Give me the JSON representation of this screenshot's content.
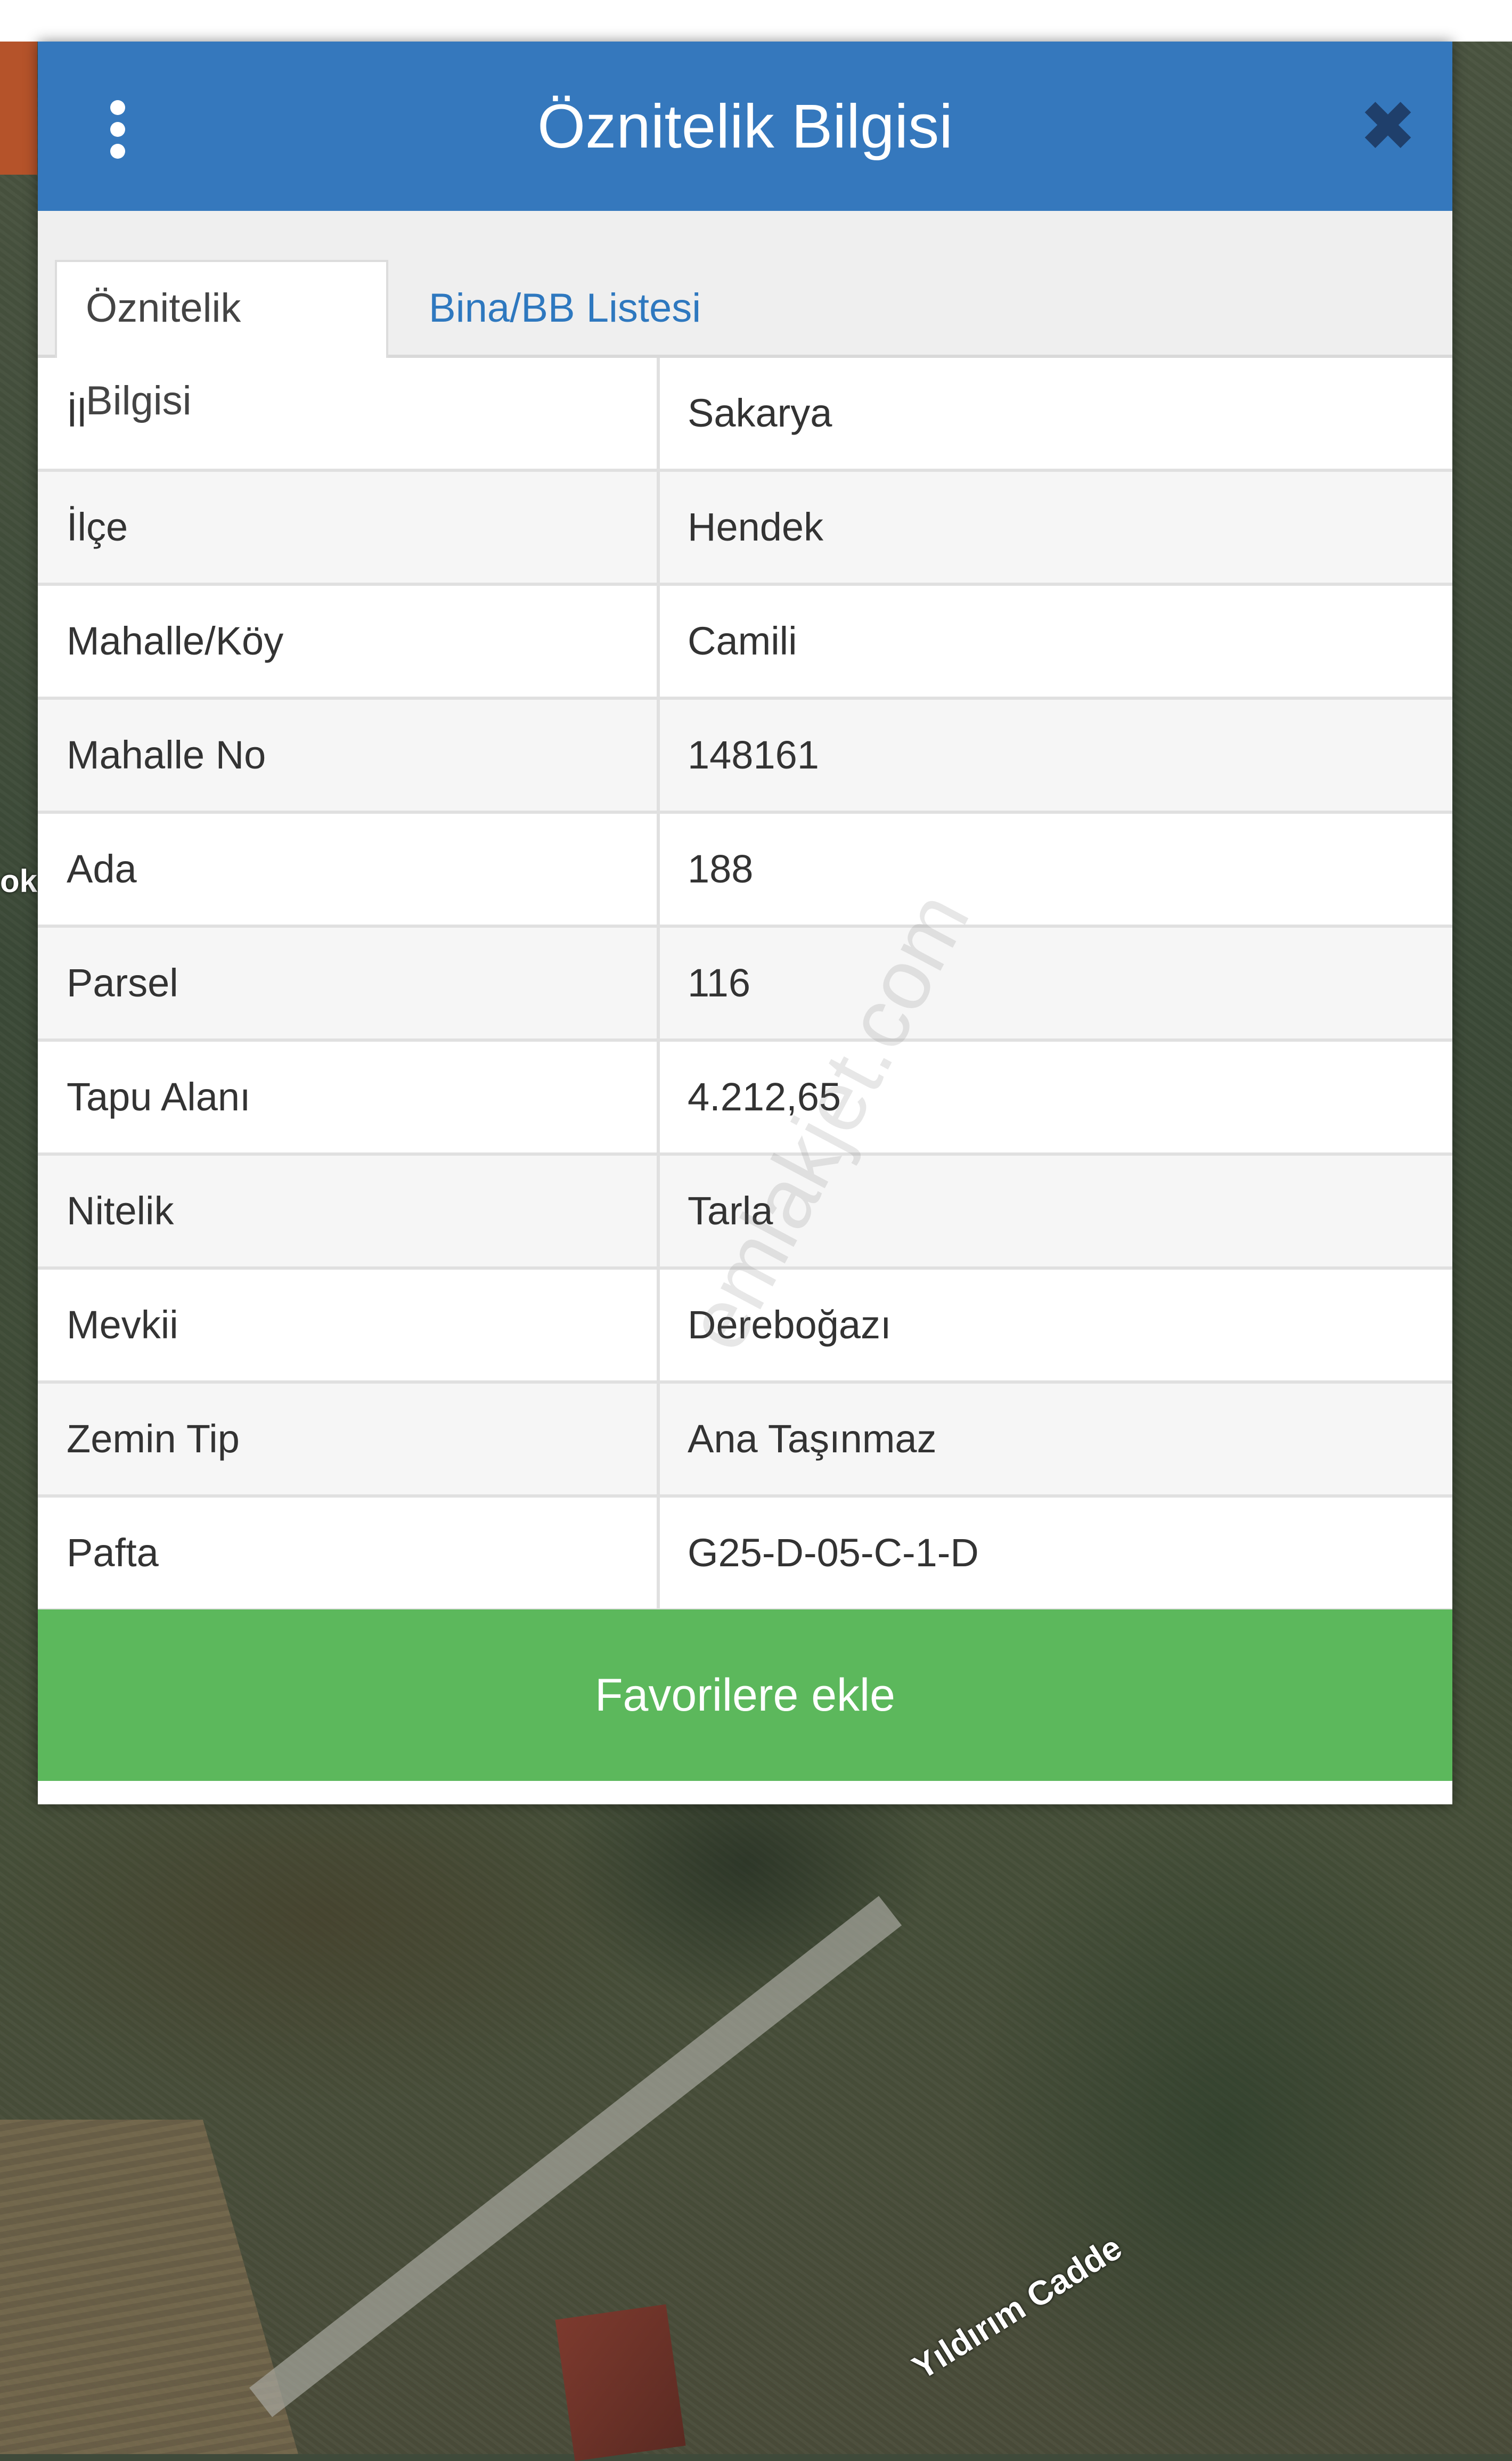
{
  "map": {
    "street_label": "Yıldırım Cadde",
    "edge_label": "ok"
  },
  "dialog": {
    "title": "Öznitelik Bilgisi",
    "menu_icon": "vertical-dots-icon",
    "close_icon": "close-icon",
    "tabs": [
      {
        "label": "Öznitelik Bilgisi",
        "active": true
      },
      {
        "label": "Bina/BB Listesi",
        "active": false
      }
    ],
    "rows": [
      {
        "label": "İl",
        "value": "Sakarya"
      },
      {
        "label": "İlçe",
        "value": "Hendek"
      },
      {
        "label": "Mahalle/Köy",
        "value": "Camili"
      },
      {
        "label": "Mahalle No",
        "value": "148161"
      },
      {
        "label": "Ada",
        "value": "188"
      },
      {
        "label": "Parsel",
        "value": "116"
      },
      {
        "label": "Tapu Alanı",
        "value": "4.212,65"
      },
      {
        "label": "Nitelik",
        "value": "Tarla"
      },
      {
        "label": "Mevkii",
        "value": "Dereboğazı"
      },
      {
        "label": "Zemin Tip",
        "value": "Ana Taşınmaz"
      },
      {
        "label": "Pafta",
        "value": "G25-D-05-C-1-D"
      }
    ],
    "favorite_button": "Favorilere ekle"
  },
  "watermark": "emlakjet.com",
  "colors": {
    "header": "#3578bd",
    "button": "#5cb85c",
    "tab_link": "#2e78bf"
  }
}
